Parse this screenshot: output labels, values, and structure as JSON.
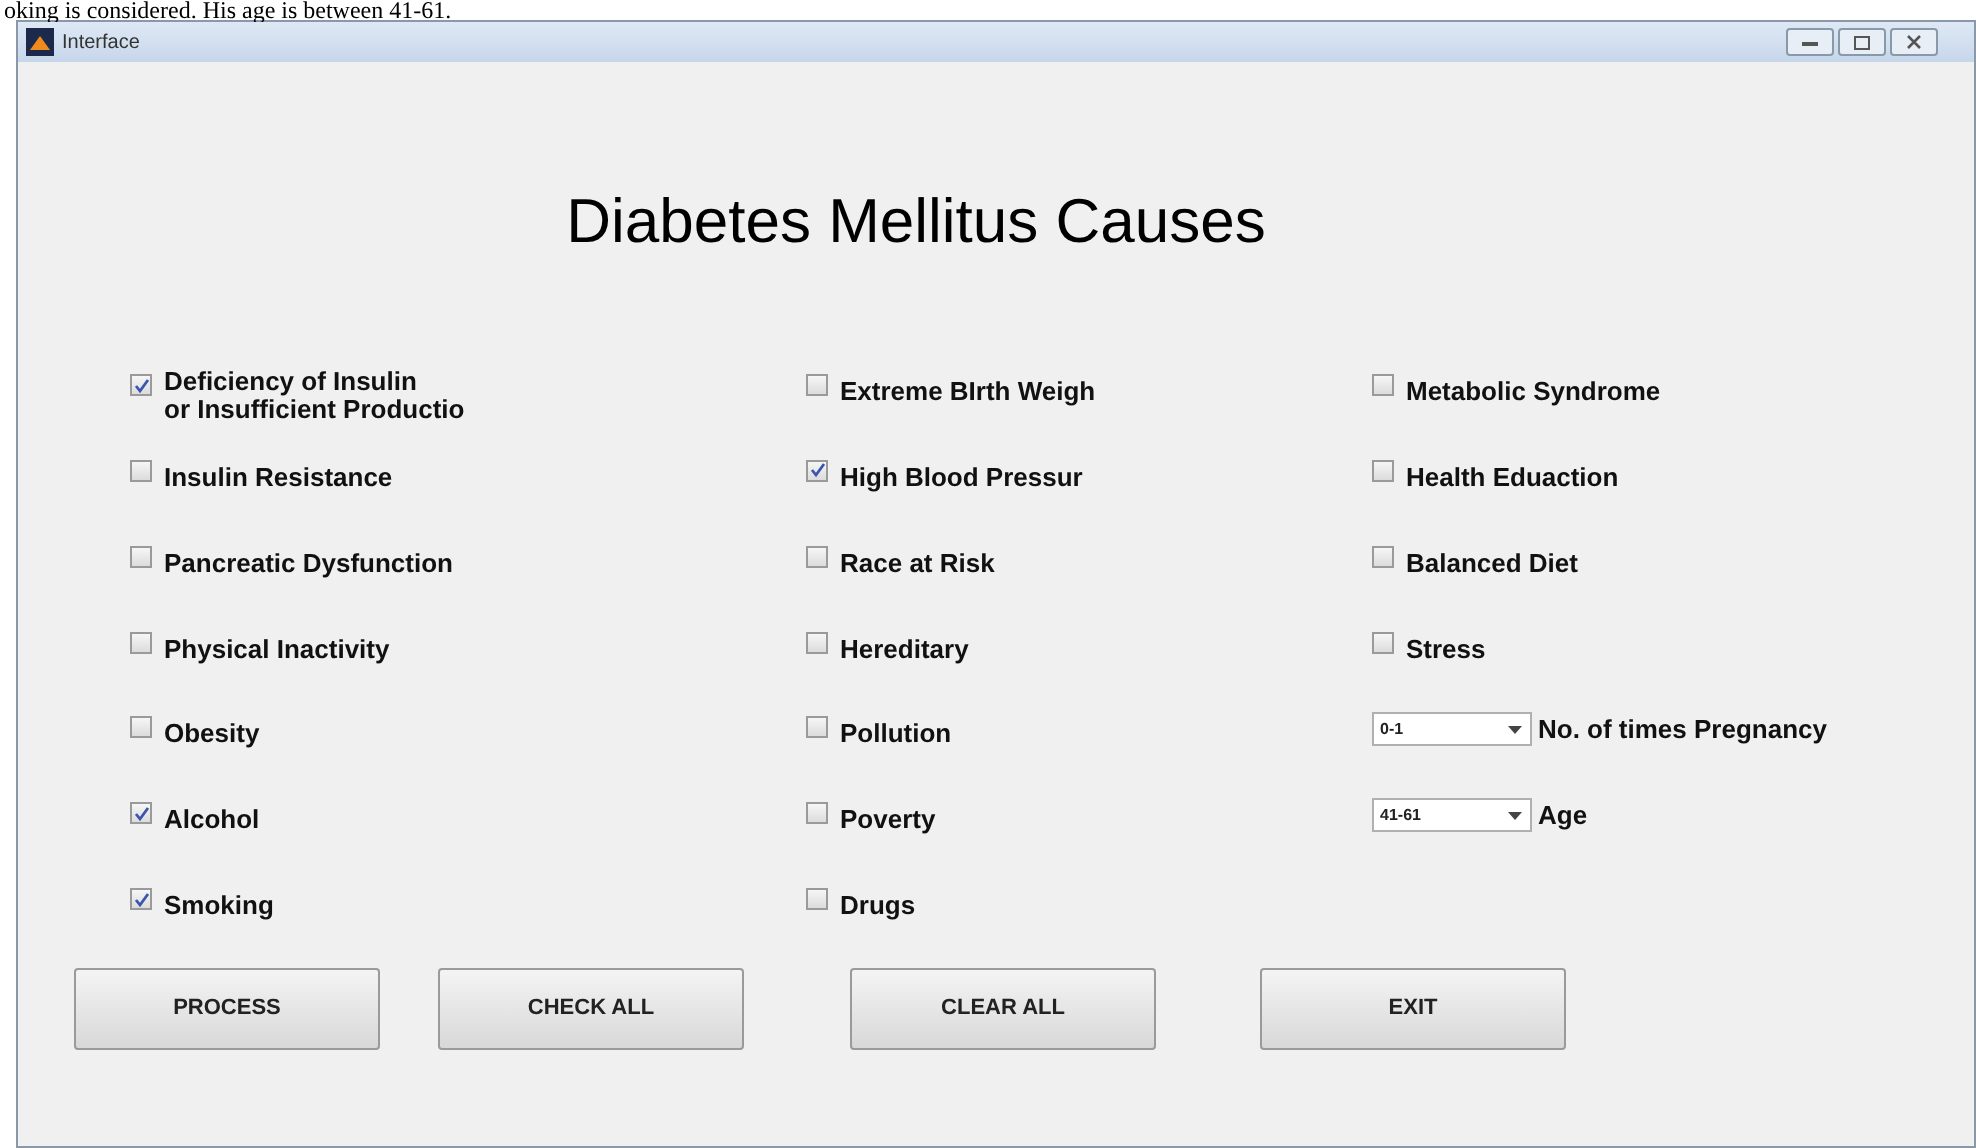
{
  "document_text": "oking is considered. His age is between 41-61.",
  "window": {
    "title": "Interface"
  },
  "heading": "Diabetes Mellitus Causes",
  "columns": [
    {
      "items": [
        {
          "kind": "checkbox",
          "label": "Deficiency of Insulin\nor Insufficient Productio",
          "checked": true
        },
        {
          "kind": "checkbox",
          "label": "Insulin Resistance",
          "checked": false
        },
        {
          "kind": "checkbox",
          "label": "Pancreatic Dysfunction",
          "checked": false
        },
        {
          "kind": "checkbox",
          "label": "Physical Inactivity",
          "checked": false
        },
        {
          "kind": "checkbox",
          "label": "Obesity",
          "checked": false
        },
        {
          "kind": "checkbox",
          "label": "Alcohol",
          "checked": true
        },
        {
          "kind": "checkbox",
          "label": "Smoking",
          "checked": true
        }
      ]
    },
    {
      "items": [
        {
          "kind": "checkbox",
          "label": "Extreme BIrth Weigh",
          "checked": false
        },
        {
          "kind": "checkbox",
          "label": "High Blood Pressur",
          "checked": true
        },
        {
          "kind": "checkbox",
          "label": "Race at Risk",
          "checked": false
        },
        {
          "kind": "checkbox",
          "label": "Hereditary",
          "checked": false
        },
        {
          "kind": "checkbox",
          "label": "Pollution",
          "checked": false
        },
        {
          "kind": "checkbox",
          "label": "Poverty",
          "checked": false
        },
        {
          "kind": "checkbox",
          "label": "Drugs",
          "checked": false
        }
      ]
    },
    {
      "items": [
        {
          "kind": "checkbox",
          "label": "Metabolic Syndrome",
          "checked": false
        },
        {
          "kind": "checkbox",
          "label": "Health Eduaction",
          "checked": false
        },
        {
          "kind": "checkbox",
          "label": "Balanced Diet",
          "checked": false
        },
        {
          "kind": "checkbox",
          "label": "Stress",
          "checked": false
        },
        {
          "kind": "dropdown",
          "value": "0-1",
          "label": "No. of times Pregnancy"
        },
        {
          "kind": "dropdown",
          "value": "41-61",
          "label": "Age"
        }
      ]
    }
  ],
  "buttons": [
    "PROCESS",
    "CHECK ALL",
    "CLEAR ALL",
    "EXIT"
  ]
}
